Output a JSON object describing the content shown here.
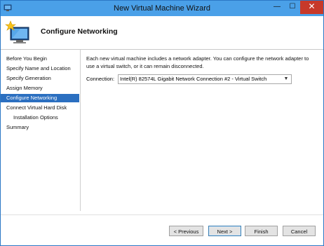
{
  "window": {
    "title": "New Virtual Machine Wizard",
    "minimize_glyph": "—",
    "maximize_glyph": "☐",
    "close_glyph": "✕"
  },
  "header": {
    "title": "Configure Networking",
    "icon": "virtual-machine-wizard-icon"
  },
  "nav": {
    "items": [
      {
        "label": "Before You Begin",
        "active": false,
        "sub": false
      },
      {
        "label": "Specify Name and Location",
        "active": false,
        "sub": false
      },
      {
        "label": "Specify Generation",
        "active": false,
        "sub": false
      },
      {
        "label": "Assign Memory",
        "active": false,
        "sub": false
      },
      {
        "label": "Configure Networking",
        "active": true,
        "sub": false
      },
      {
        "label": "Connect Virtual Hard Disk",
        "active": false,
        "sub": false
      },
      {
        "label": "Installation Options",
        "active": false,
        "sub": true
      },
      {
        "label": "Summary",
        "active": false,
        "sub": false
      }
    ]
  },
  "main": {
    "description": "Each new virtual machine includes a network adapter. You can configure the network adapter to use a virtual switch, or it can remain disconnected.",
    "connection_label": "Connection:",
    "connection_value": "Intel(R) 82574L Gigabit Network Connection #2 - Virtual Switch"
  },
  "buttons": {
    "previous": "< Previous",
    "next": "Next >",
    "finish": "Finish",
    "cancel": "Cancel"
  },
  "colors": {
    "titlebar": "#4aa0e8",
    "selection": "#2b6fc0",
    "close": "#c7392a"
  }
}
